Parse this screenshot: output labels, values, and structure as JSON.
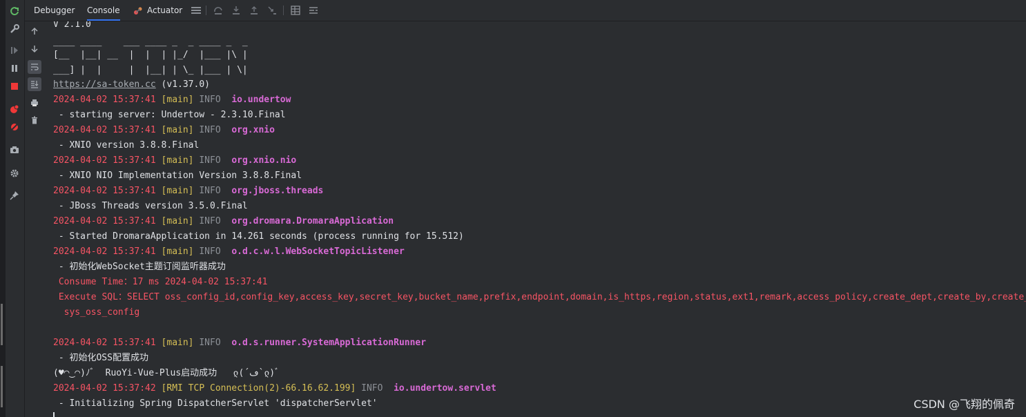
{
  "tabs": [
    "Debugger",
    "Console",
    "Actuator"
  ],
  "active_tab": "Console",
  "colors": {
    "background": "#2b2d30",
    "timestamp": "#f75464",
    "thread": "#d6bf55",
    "logger": "#d96ad6",
    "sql": "#f75464",
    "active_tab_underline": "#3574f0"
  },
  "console": {
    "version": "V 2.1.0",
    "banner": [
      "____ ____    ___ ____ _  _ ____ _  _",
      "[__  |__| __  |  |  | |_/  |___ |\\ |",
      "___] |  |     |  |__| | \\_ |___ | \\|"
    ],
    "url": "https://sa-token.cc",
    "url_suffix": " (v1.37.0)",
    "logs": [
      {
        "ts": "2024-04-02 15:37:41",
        "thread": "[main]",
        "level": "INFO ",
        "logger": "io.undertow",
        "msg": " - starting server: Undertow - 2.3.10.Final"
      },
      {
        "ts": "2024-04-02 15:37:41",
        "thread": "[main]",
        "level": "INFO ",
        "logger": "org.xnio",
        "msg": " - XNIO version 3.8.8.Final"
      },
      {
        "ts": "2024-04-02 15:37:41",
        "thread": "[main]",
        "level": "INFO ",
        "logger": "org.xnio.nio",
        "msg": " - XNIO NIO Implementation Version 3.8.8.Final"
      },
      {
        "ts": "2024-04-02 15:37:41",
        "thread": "[main]",
        "level": "INFO ",
        "logger": "org.jboss.threads",
        "msg": " - JBoss Threads version 3.5.0.Final"
      },
      {
        "ts": "2024-04-02 15:37:41",
        "thread": "[main]",
        "level": "INFO ",
        "logger": "org.dromara.DromaraApplication",
        "msg": " - Started DromaraApplication in 14.261 seconds (process running for 15.512)"
      },
      {
        "ts": "2024-04-02 15:37:41",
        "thread": "[main]",
        "level": "INFO ",
        "logger": "o.d.c.w.l.WebSocketTopicListener",
        "msg": " - 初始化WebSocket主题订阅监听器成功"
      }
    ],
    "sql_lines": [
      " Consume Time：17 ms 2024-04-02 15:37:41",
      " Execute SQL：SELECT oss_config_id,config_key,access_key,secret_key,bucket_name,prefix,endpoint,domain,is_https,region,status,ext1,remark,access_policy,create_dept,create_by,create_time,update_by,update_time FROM",
      "  sys_oss_config"
    ],
    "log_runner": {
      "ts": "2024-04-02 15:37:41",
      "thread": "[main]",
      "level": "INFO ",
      "logger": "o.d.s.runner.SystemApplicationRunner",
      "msg": " - 初始化OSS配置成功"
    },
    "startup_msg": "(♥◠‿◠)ﾉﾞ  RuoYi-Vue-Plus启动成功   ლ(´ڡ`ლ)ﾞ",
    "log_servlet": {
      "ts": "2024-04-02 15:37:42",
      "thread": "[RMI TCP Connection(2)-66.16.62.199]",
      "level": "INFO ",
      "logger": "io.undertow.servlet",
      "msg": " - Initializing Spring DispatcherServlet 'dispatcherServlet'"
    }
  },
  "icons": {
    "toolstrip": [
      "rerun-icon",
      "wrench-icon",
      "resume-icon",
      "pause-icon",
      "stop-icon",
      "breakpoints-icon",
      "mute-breakpoints-icon",
      "camera-icon",
      "settings-icon",
      "pin-icon"
    ],
    "topbar": [
      "menu-icon",
      "step-over-icon",
      "step-into-icon",
      "step-out-icon",
      "run-to-cursor-icon",
      "table-icon",
      "threads-icon"
    ],
    "gutter": [
      "up-arrow-icon",
      "down-arrow-icon",
      "soft-wrap-icon",
      "scroll-to-end-icon",
      "print-icon",
      "trash-icon"
    ]
  },
  "watermark": "CSDN @飞翔的佩奇"
}
